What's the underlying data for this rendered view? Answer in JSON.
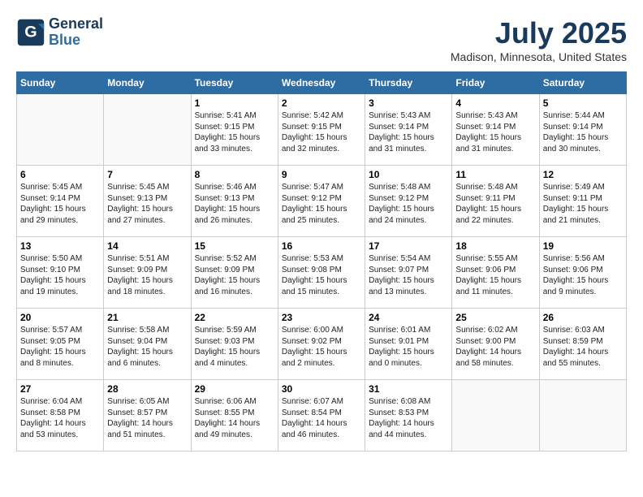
{
  "header": {
    "logo_line1": "General",
    "logo_line2": "Blue",
    "title": "July 2025",
    "location": "Madison, Minnesota, United States"
  },
  "days_of_week": [
    "Sunday",
    "Monday",
    "Tuesday",
    "Wednesday",
    "Thursday",
    "Friday",
    "Saturday"
  ],
  "weeks": [
    [
      {
        "num": "",
        "sunrise": "",
        "sunset": "",
        "daylight": ""
      },
      {
        "num": "",
        "sunrise": "",
        "sunset": "",
        "daylight": ""
      },
      {
        "num": "1",
        "sunrise": "Sunrise: 5:41 AM",
        "sunset": "Sunset: 9:15 PM",
        "daylight": "Daylight: 15 hours and 33 minutes."
      },
      {
        "num": "2",
        "sunrise": "Sunrise: 5:42 AM",
        "sunset": "Sunset: 9:15 PM",
        "daylight": "Daylight: 15 hours and 32 minutes."
      },
      {
        "num": "3",
        "sunrise": "Sunrise: 5:43 AM",
        "sunset": "Sunset: 9:14 PM",
        "daylight": "Daylight: 15 hours and 31 minutes."
      },
      {
        "num": "4",
        "sunrise": "Sunrise: 5:43 AM",
        "sunset": "Sunset: 9:14 PM",
        "daylight": "Daylight: 15 hours and 31 minutes."
      },
      {
        "num": "5",
        "sunrise": "Sunrise: 5:44 AM",
        "sunset": "Sunset: 9:14 PM",
        "daylight": "Daylight: 15 hours and 30 minutes."
      }
    ],
    [
      {
        "num": "6",
        "sunrise": "Sunrise: 5:45 AM",
        "sunset": "Sunset: 9:14 PM",
        "daylight": "Daylight: 15 hours and 29 minutes."
      },
      {
        "num": "7",
        "sunrise": "Sunrise: 5:45 AM",
        "sunset": "Sunset: 9:13 PM",
        "daylight": "Daylight: 15 hours and 27 minutes."
      },
      {
        "num": "8",
        "sunrise": "Sunrise: 5:46 AM",
        "sunset": "Sunset: 9:13 PM",
        "daylight": "Daylight: 15 hours and 26 minutes."
      },
      {
        "num": "9",
        "sunrise": "Sunrise: 5:47 AM",
        "sunset": "Sunset: 9:12 PM",
        "daylight": "Daylight: 15 hours and 25 minutes."
      },
      {
        "num": "10",
        "sunrise": "Sunrise: 5:48 AM",
        "sunset": "Sunset: 9:12 PM",
        "daylight": "Daylight: 15 hours and 24 minutes."
      },
      {
        "num": "11",
        "sunrise": "Sunrise: 5:48 AM",
        "sunset": "Sunset: 9:11 PM",
        "daylight": "Daylight: 15 hours and 22 minutes."
      },
      {
        "num": "12",
        "sunrise": "Sunrise: 5:49 AM",
        "sunset": "Sunset: 9:11 PM",
        "daylight": "Daylight: 15 hours and 21 minutes."
      }
    ],
    [
      {
        "num": "13",
        "sunrise": "Sunrise: 5:50 AM",
        "sunset": "Sunset: 9:10 PM",
        "daylight": "Daylight: 15 hours and 19 minutes."
      },
      {
        "num": "14",
        "sunrise": "Sunrise: 5:51 AM",
        "sunset": "Sunset: 9:09 PM",
        "daylight": "Daylight: 15 hours and 18 minutes."
      },
      {
        "num": "15",
        "sunrise": "Sunrise: 5:52 AM",
        "sunset": "Sunset: 9:09 PM",
        "daylight": "Daylight: 15 hours and 16 minutes."
      },
      {
        "num": "16",
        "sunrise": "Sunrise: 5:53 AM",
        "sunset": "Sunset: 9:08 PM",
        "daylight": "Daylight: 15 hours and 15 minutes."
      },
      {
        "num": "17",
        "sunrise": "Sunrise: 5:54 AM",
        "sunset": "Sunset: 9:07 PM",
        "daylight": "Daylight: 15 hours and 13 minutes."
      },
      {
        "num": "18",
        "sunrise": "Sunrise: 5:55 AM",
        "sunset": "Sunset: 9:06 PM",
        "daylight": "Daylight: 15 hours and 11 minutes."
      },
      {
        "num": "19",
        "sunrise": "Sunrise: 5:56 AM",
        "sunset": "Sunset: 9:06 PM",
        "daylight": "Daylight: 15 hours and 9 minutes."
      }
    ],
    [
      {
        "num": "20",
        "sunrise": "Sunrise: 5:57 AM",
        "sunset": "Sunset: 9:05 PM",
        "daylight": "Daylight: 15 hours and 8 minutes."
      },
      {
        "num": "21",
        "sunrise": "Sunrise: 5:58 AM",
        "sunset": "Sunset: 9:04 PM",
        "daylight": "Daylight: 15 hours and 6 minutes."
      },
      {
        "num": "22",
        "sunrise": "Sunrise: 5:59 AM",
        "sunset": "Sunset: 9:03 PM",
        "daylight": "Daylight: 15 hours and 4 minutes."
      },
      {
        "num": "23",
        "sunrise": "Sunrise: 6:00 AM",
        "sunset": "Sunset: 9:02 PM",
        "daylight": "Daylight: 15 hours and 2 minutes."
      },
      {
        "num": "24",
        "sunrise": "Sunrise: 6:01 AM",
        "sunset": "Sunset: 9:01 PM",
        "daylight": "Daylight: 15 hours and 0 minutes."
      },
      {
        "num": "25",
        "sunrise": "Sunrise: 6:02 AM",
        "sunset": "Sunset: 9:00 PM",
        "daylight": "Daylight: 14 hours and 58 minutes."
      },
      {
        "num": "26",
        "sunrise": "Sunrise: 6:03 AM",
        "sunset": "Sunset: 8:59 PM",
        "daylight": "Daylight: 14 hours and 55 minutes."
      }
    ],
    [
      {
        "num": "27",
        "sunrise": "Sunrise: 6:04 AM",
        "sunset": "Sunset: 8:58 PM",
        "daylight": "Daylight: 14 hours and 53 minutes."
      },
      {
        "num": "28",
        "sunrise": "Sunrise: 6:05 AM",
        "sunset": "Sunset: 8:57 PM",
        "daylight": "Daylight: 14 hours and 51 minutes."
      },
      {
        "num": "29",
        "sunrise": "Sunrise: 6:06 AM",
        "sunset": "Sunset: 8:55 PM",
        "daylight": "Daylight: 14 hours and 49 minutes."
      },
      {
        "num": "30",
        "sunrise": "Sunrise: 6:07 AM",
        "sunset": "Sunset: 8:54 PM",
        "daylight": "Daylight: 14 hours and 46 minutes."
      },
      {
        "num": "31",
        "sunrise": "Sunrise: 6:08 AM",
        "sunset": "Sunset: 8:53 PM",
        "daylight": "Daylight: 14 hours and 44 minutes."
      },
      {
        "num": "",
        "sunrise": "",
        "sunset": "",
        "daylight": ""
      },
      {
        "num": "",
        "sunrise": "",
        "sunset": "",
        "daylight": ""
      }
    ]
  ]
}
